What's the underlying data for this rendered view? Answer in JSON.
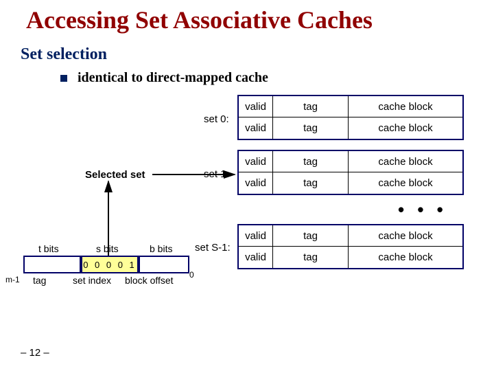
{
  "title": "Accessing Set Associative Caches",
  "subtitle": "Set selection",
  "bullet": "identical to direct-mapped cache",
  "slide_number": "– 12 –",
  "selected_label": "Selected set",
  "ellipsis": "• • •",
  "set_labels": {
    "s0": "set 0:",
    "s1": "set 1:",
    "slast": "set S-1:"
  },
  "cols": {
    "valid": "valid",
    "tag": "tag",
    "block": "cache block"
  },
  "address": {
    "t_top": "t bits",
    "s_top": "s bits",
    "b_top": "b bits",
    "s_digits": "0 0   0 0 1",
    "tag_lab": "tag",
    "setidx_lab": "set index",
    "blockoff_lab": "block offset",
    "msb": "m-1",
    "lsb": "0"
  }
}
